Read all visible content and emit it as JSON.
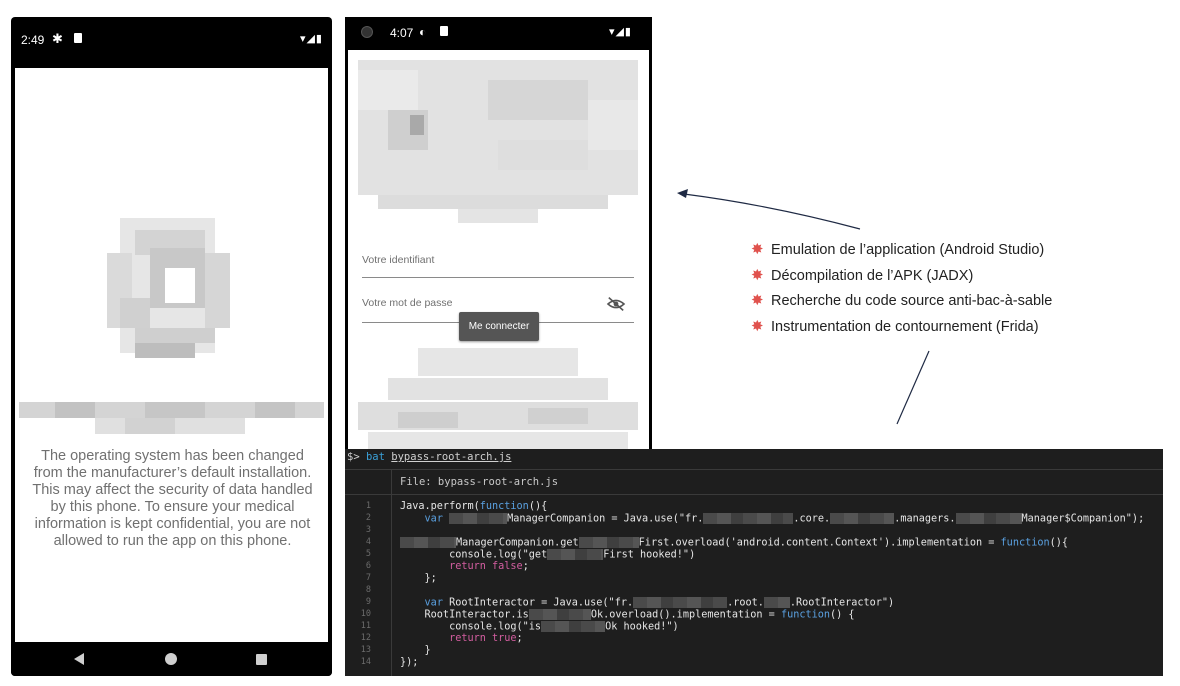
{
  "phone1": {
    "status": {
      "time": "2:49",
      "gear_icon": "gear-icon",
      "sd_icon": "sd-card-icon",
      "signal_icons": "▾◢▮"
    },
    "message": "The operating system has been changed from the manufacturer’s default installation. This may affect the security of data handled by this phone. To ensure your medical information is kept confidential, you are not allowed to run the app on this phone."
  },
  "phone2": {
    "status": {
      "time": "4:07",
      "logo_icon": "app-icon",
      "signal_icons": "▾◢▮"
    },
    "login": {
      "identifier_label": "Votre identifiant",
      "password_label": "Votre mot de passe",
      "submit_label": "Me connecter"
    }
  },
  "bullets": {
    "items": [
      {
        "label": "Emulation de l’application (Android Studio)"
      },
      {
        "label": "Décompilation de l’APK (JADX)"
      },
      {
        "label": "Recherche du code source anti-bac-à-sable"
      },
      {
        "label": "Instrumentation de contournement (Frida)"
      }
    ],
    "accent_color": "#e0524d"
  },
  "terminal": {
    "prompt": "$>",
    "command": "bat",
    "filename": "bypass-root-arch.js",
    "file_header": "File: bypass-root-arch.js",
    "line_numbers": [
      "1",
      "2",
      "3",
      "4",
      "5",
      "6",
      "7",
      "8",
      "9",
      "10",
      "11",
      "12",
      "13",
      "14"
    ]
  }
}
